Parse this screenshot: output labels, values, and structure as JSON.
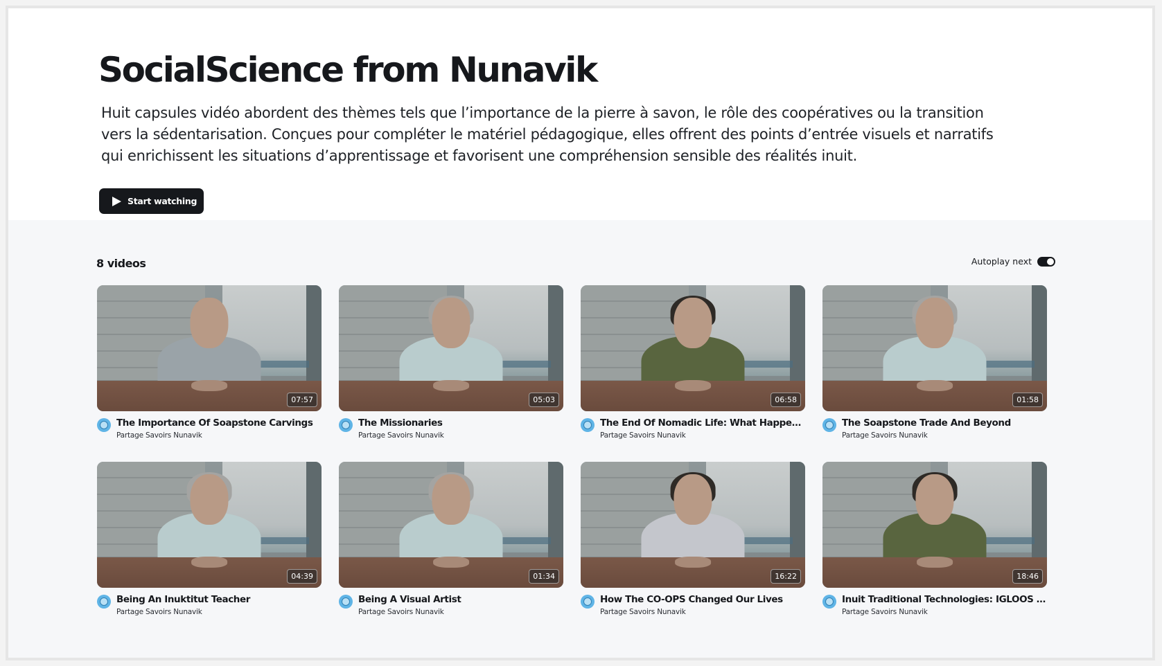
{
  "hero": {
    "title": "SocialScience from Nunavik",
    "description": "Huit capsules vidéo abordent des thèmes tels que l’importance de la pierre à savon, le rôle des coopératives ou la transition vers la sédentarisation. Conçues pour compléter le matériel pédagogique, elles offrent des points d’entrée visuels et narratifs qui enrichissent les situations d’apprentissage et favorisent une compréhension sensible des réalités inuit.",
    "start_button_label": "Start watching"
  },
  "list": {
    "count_label": "8 videos",
    "autoplay_label": "Autoplay next",
    "autoplay_on": true
  },
  "videos": [
    {
      "title": "The Importance Of Soapstone Carvings",
      "channel": "Partage Savoirs Nunavik",
      "duration": "07:57",
      "shirt": "#9aa3a8",
      "hair": "none"
    },
    {
      "title": "The Missionaries",
      "channel": "Partage Savoirs Nunavik",
      "duration": "05:03",
      "shirt": "#b9cccd",
      "hair": "#a4a4a2"
    },
    {
      "title": "The End Of Nomadic Life: What Happene...",
      "channel": "Partage Savoirs Nunavik",
      "duration": "06:58",
      "shirt": "#59653f",
      "hair": "#2e2a26"
    },
    {
      "title": "The Soapstone Trade And Beyond",
      "channel": "Partage Savoirs Nunavik",
      "duration": "01:58",
      "shirt": "#b9cccd",
      "hair": "#a4a4a2"
    },
    {
      "title": "Being An Inuktitut Teacher",
      "channel": "Partage Savoirs Nunavik",
      "duration": "04:39",
      "shirt": "#b9cccd",
      "hair": "#a4a4a2"
    },
    {
      "title": "Being A Visual Artist",
      "channel": "Partage Savoirs Nunavik",
      "duration": "01:34",
      "shirt": "#b9cccd",
      "hair": "#a4a4a2"
    },
    {
      "title": "How The CO-OPS Changed Our Lives",
      "channel": "Partage Savoirs Nunavik",
      "duration": "16:22",
      "shirt": "#c4c6cc",
      "hair": "#2e2a26"
    },
    {
      "title": "Inuit Traditional Technologies: IGLOOS A...",
      "channel": "Partage Savoirs Nunavik",
      "duration": "18:46",
      "shirt": "#59653f",
      "hair": "#2e2a26"
    }
  ]
}
